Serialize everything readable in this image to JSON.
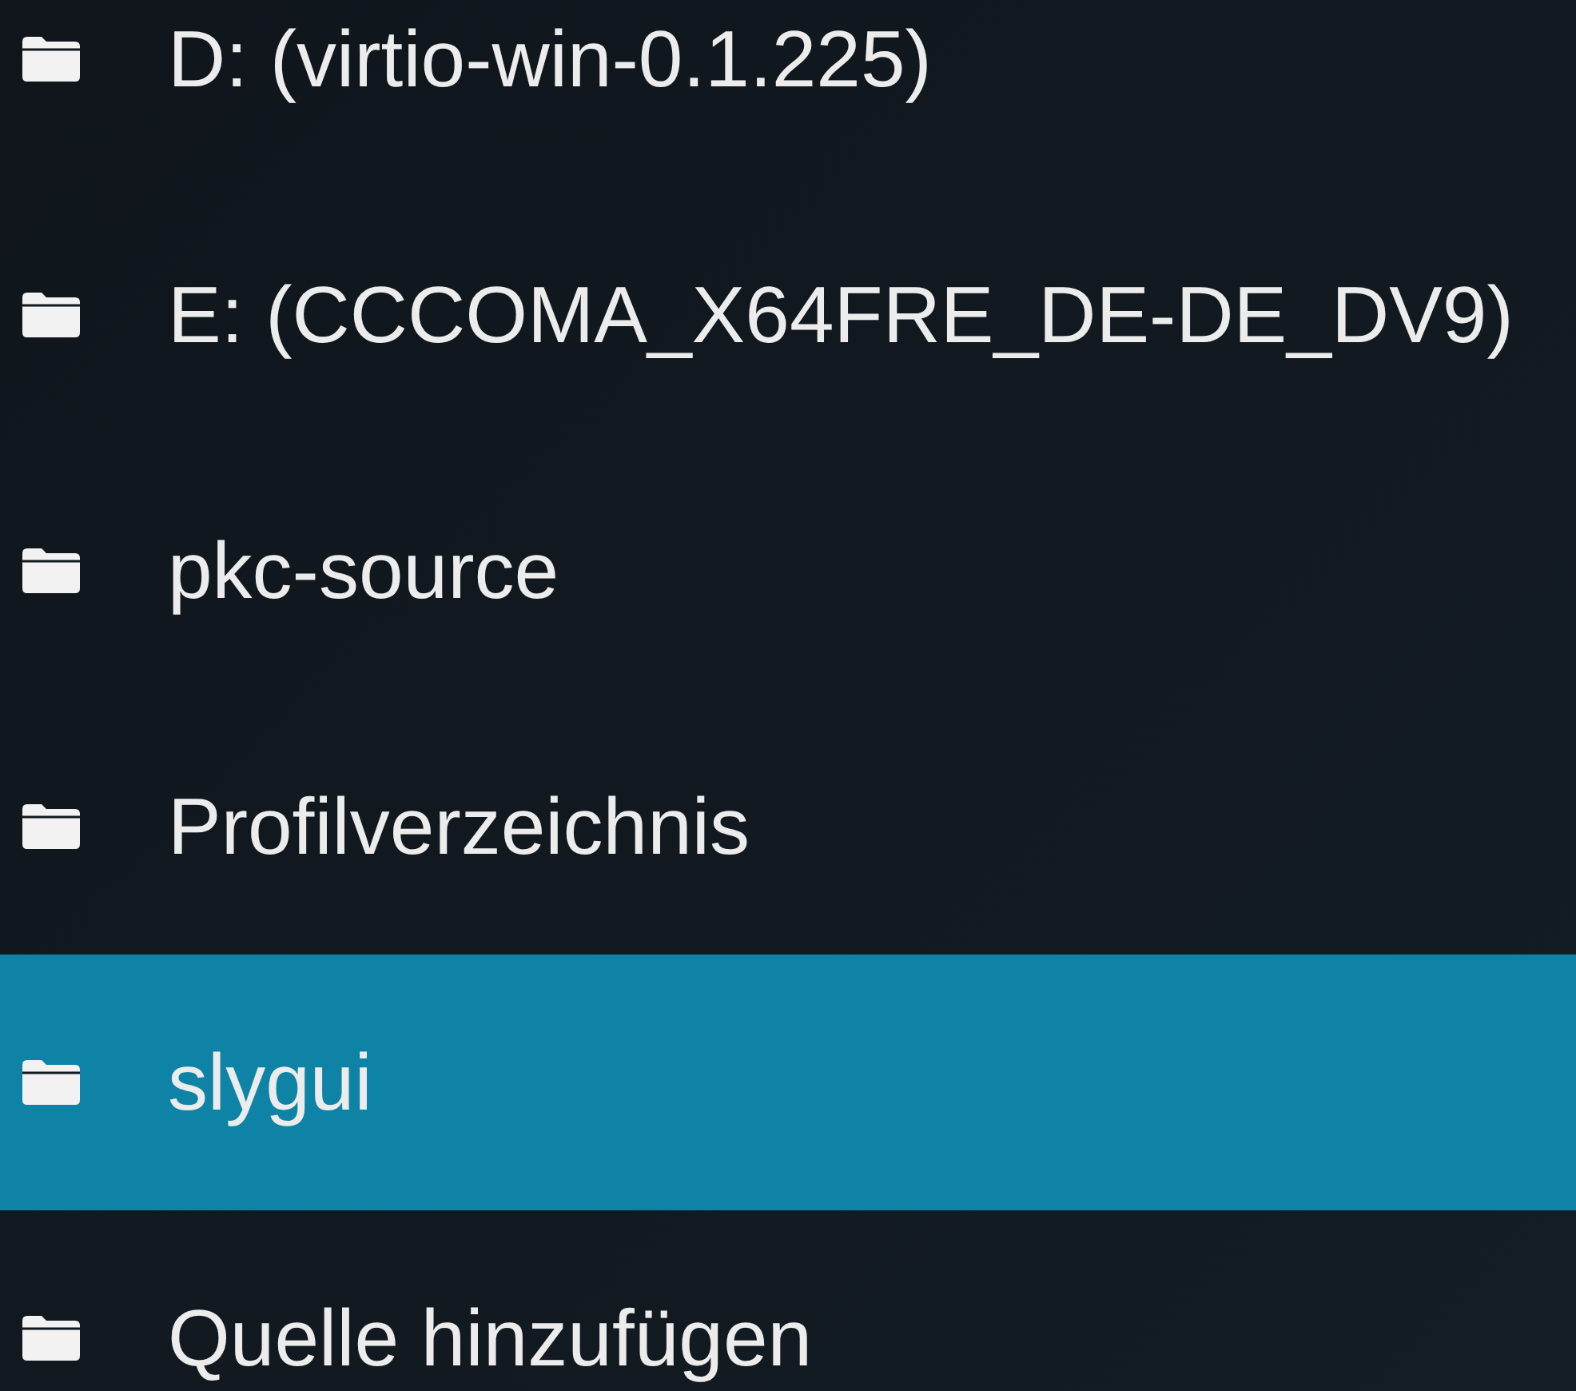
{
  "sources": [
    {
      "label": "D: (virtio-win-0.1.225)",
      "selected": false
    },
    {
      "label": "E: (CCCOMA_X64FRE_DE-DE_DV9)",
      "selected": false
    },
    {
      "label": "pkc-source",
      "selected": false
    },
    {
      "label": "Profilverzeichnis",
      "selected": false
    },
    {
      "label": "slygui",
      "selected": true
    },
    {
      "label": "Quelle hinzufügen",
      "selected": false
    }
  ]
}
